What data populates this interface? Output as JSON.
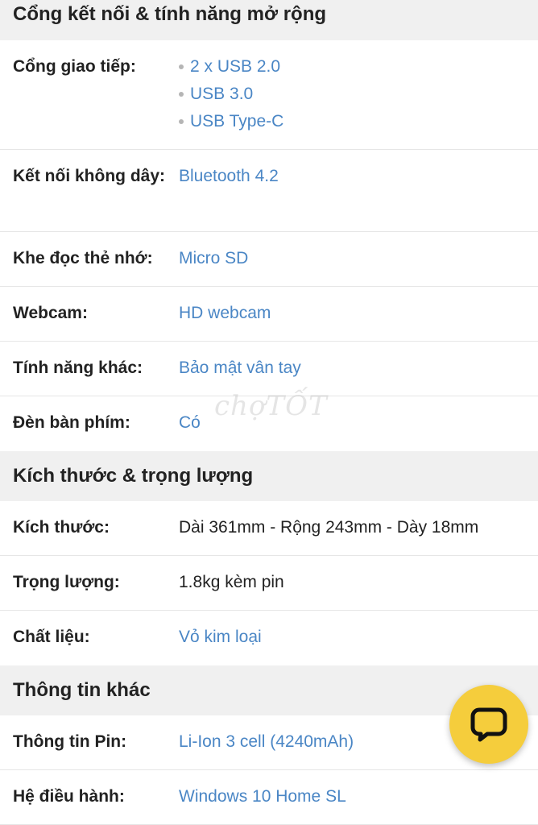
{
  "sections": [
    {
      "title": "Cổng kết nối & tính năng mở rộng",
      "rows": [
        {
          "label": "Cổng giao tiếp:",
          "values": [
            "2 x USB 2.0",
            "USB 3.0",
            "USB Type-C"
          ]
        },
        {
          "label": "Kết nối không dây:",
          "value": "Bluetooth 4.2"
        },
        {
          "label": "Khe đọc thẻ nhớ:",
          "value": "Micro SD"
        },
        {
          "label": "Webcam:",
          "value": "HD webcam"
        },
        {
          "label": "Tính năng khác:",
          "value": "Bảo mật vân tay"
        },
        {
          "label": "Đèn bàn phím:",
          "value": "Có"
        }
      ]
    },
    {
      "title": "Kích thước & trọng lượng",
      "rows": [
        {
          "label": "Kích thước:",
          "value": "Dài 361mm - Rộng 243mm - Dày 18mm"
        },
        {
          "label": "Trọng lượng:",
          "value": "1.8kg kèm pin"
        },
        {
          "label": "Chất liệu:",
          "value": "Vỏ kim loại"
        }
      ]
    },
    {
      "title": "Thông tin khác",
      "rows": [
        {
          "label": "Thông tin Pin:",
          "value": "Li-Ion 3 cell (4240mAh)"
        },
        {
          "label": "Hệ điều hành:",
          "value": "Windows 10 Home SL"
        }
      ]
    }
  ],
  "watermark": "chợTỐT",
  "chat_button": {
    "icon": "chat-bubble-icon",
    "color": "#f5cd3c"
  },
  "colors": {
    "link": "#4a86c5",
    "header_bg": "#f0f0f0",
    "text": "#222222"
  }
}
